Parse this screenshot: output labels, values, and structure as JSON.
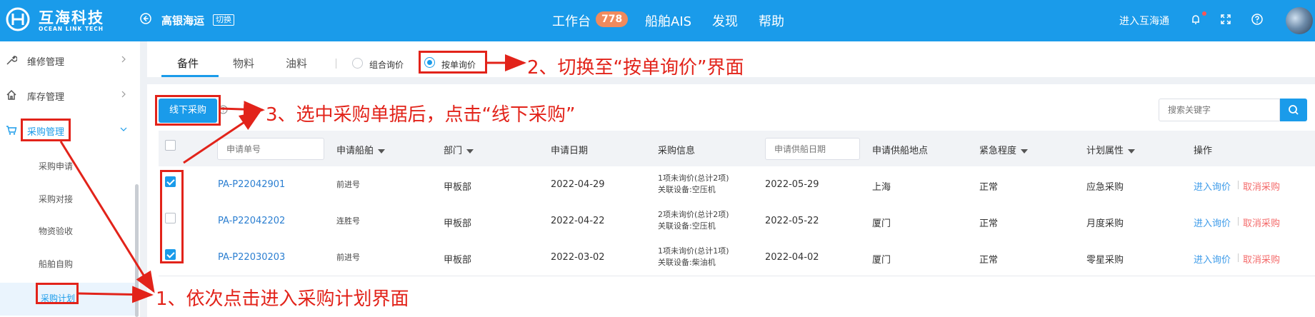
{
  "header": {
    "brand": "互海科技",
    "brand_sub": "OCEAN LINK TECH",
    "company": "高银海运",
    "switch_label": "切换",
    "nav": [
      {
        "label": "工作台",
        "badge": "778"
      },
      {
        "label": "船舶AIS"
      },
      {
        "label": "发现"
      },
      {
        "label": "帮助"
      }
    ],
    "enter_hub": "进入互海通"
  },
  "sidebar": {
    "items": [
      {
        "label": "维修管理",
        "icon": "wrench-icon"
      },
      {
        "label": "库存管理",
        "icon": "home-icon"
      },
      {
        "label": "采购管理",
        "icon": "cart-icon"
      }
    ],
    "subitems": [
      "采购申请",
      "采购对接",
      "物资验收",
      "船舶自购",
      "采购计划"
    ],
    "active": "采购计划"
  },
  "tabs": {
    "items": [
      "备件",
      "物料",
      "油料"
    ],
    "active": "备件",
    "radio": [
      {
        "label": "组合询价",
        "checked": false
      },
      {
        "label": "按单询价",
        "checked": true
      }
    ]
  },
  "toolbar": {
    "offline_button": "线下采购",
    "search_placeholder": "搜索关键字"
  },
  "table": {
    "headers": {
      "request_no_placeholder": "申请单号",
      "vessel": "申请船舶",
      "dept": "部门",
      "date": "申请日期",
      "purchase_info": "采购信息",
      "supply_date_placeholder": "申请供船日期",
      "location": "申请供船地点",
      "urgency": "紧急程度",
      "plan_attr": "计划属性",
      "ops": "操作"
    },
    "rows": [
      {
        "checked": true,
        "no": "PA-P22042901",
        "vessel": "前进号",
        "dept": "甲板部",
        "date": "2022-04-29",
        "info1": "1项未询价(总计2项)",
        "info2": "关联设备:空压机",
        "supply_date": "2022-05-29",
        "location": "上海",
        "urgency": "正常",
        "plan": "应急采购",
        "op_enter": "进入询价",
        "op_cancel": "取消采购"
      },
      {
        "checked": false,
        "no": "PA-P22042202",
        "vessel": "连胜号",
        "dept": "甲板部",
        "date": "2022-04-22",
        "info1": "2项未询价(总计2项)",
        "info2": "关联设备:空压机",
        "supply_date": "2022-05-22",
        "location": "厦门",
        "urgency": "正常",
        "plan": "月度采购",
        "op_enter": "进入询价",
        "op_cancel": "取消采购"
      },
      {
        "checked": true,
        "no": "PA-P22030203",
        "vessel": "前进号",
        "dept": "甲板部",
        "date": "2022-03-02",
        "info1": "1项未询价(总计1项)",
        "info2": "关联设备:柴油机",
        "supply_date": "2022-04-02",
        "location": "厦门",
        "urgency": "正常",
        "plan": "零星采购",
        "op_enter": "进入询价",
        "op_cancel": "取消采购"
      }
    ]
  },
  "annotations": {
    "step1": "1、依次点击进入采购计划界面",
    "step2": "2、切换至“按单询价”界面",
    "step3": "3、选中采购单据后，点击“线下采购”"
  },
  "colors": {
    "primary": "#1a9bea",
    "annotation": "#e2231a",
    "badge": "#f08a5d"
  }
}
